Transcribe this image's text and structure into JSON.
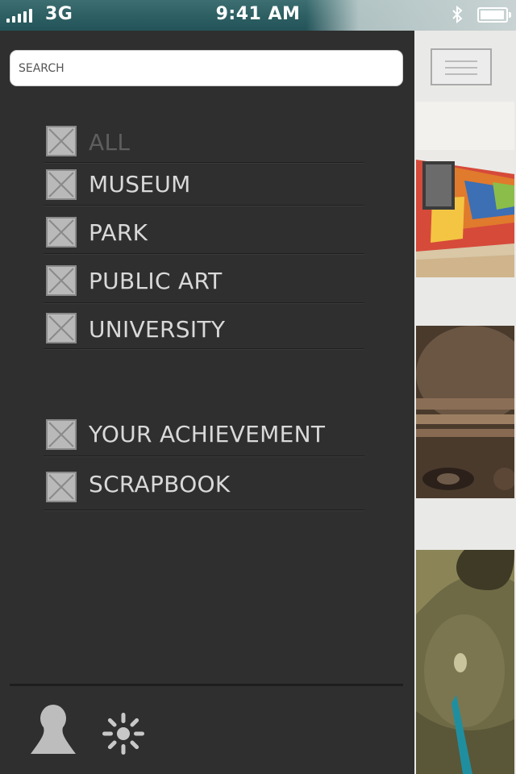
{
  "status_bar": {
    "network": "3G",
    "time": "9:41 AM",
    "signal_bars": 5,
    "battery_level": 0.95,
    "icons": [
      "signal-icon",
      "bluetooth-icon",
      "battery-icon"
    ]
  },
  "drawer": {
    "search": {
      "placeholder": "SEARCH",
      "value": ""
    },
    "categories": [
      {
        "label": "ALL",
        "checked": true,
        "dimmed": true
      },
      {
        "label": "MUSEUM",
        "checked": true,
        "dimmed": false
      },
      {
        "label": "PARK",
        "checked": true,
        "dimmed": false
      },
      {
        "label": "PUBLIC ART",
        "checked": true,
        "dimmed": false
      },
      {
        "label": "UNIVERSITY",
        "checked": true,
        "dimmed": false
      }
    ],
    "extras": [
      {
        "label": "YOUR ACHIEVEMENT",
        "checked": true
      },
      {
        "label": "SCRAPBOOK",
        "checked": true
      }
    ],
    "footer_icons": [
      "profile-icon",
      "settings-icon"
    ]
  },
  "content": {
    "menu_icon": "hamburger-menu-icon",
    "thumbnails": [
      "colorful-mural-photo",
      "carved-mask-photo",
      "bronze-sculpture-photo"
    ]
  },
  "colors": {
    "drawer_bg": "#2f2f2f",
    "label_text": "#d9d9d9",
    "label_dim": "#5e5e5e",
    "checkbox_fill": "#b9b9b9",
    "statusbar_bg": "#2c5e62"
  }
}
